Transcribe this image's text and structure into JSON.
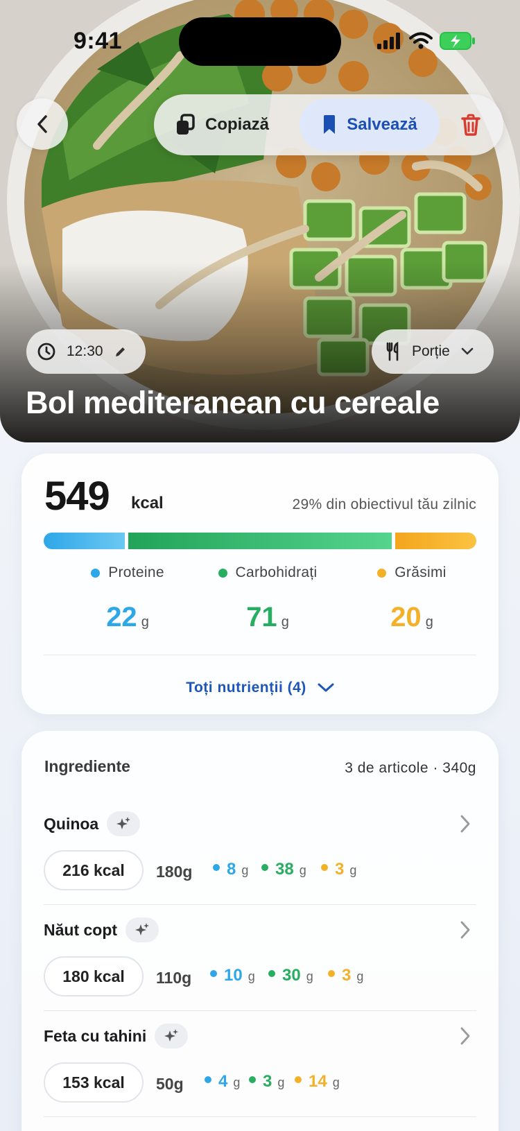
{
  "status_bar": {
    "time": "9:41"
  },
  "header": {
    "copy_label": "Copiază",
    "save_label": "Salvează",
    "time_value": "12:30",
    "portion_label": "Porție",
    "title": "Bol mediteranean cu cereale"
  },
  "nutrition": {
    "kcal": "549",
    "kcal_unit": "kcal",
    "goal_text": "29% din obiectivul tău zilnic",
    "bar_fractions": {
      "protein": 0.19,
      "carbs": 0.62,
      "fat": 0.19
    },
    "macros": [
      {
        "label": "Proteine",
        "value": "22",
        "unit": "g",
        "color": "#2ea7e8"
      },
      {
        "label": "Carbohidrați",
        "value": "71",
        "unit": "g",
        "color": "#27ae60"
      },
      {
        "label": "Grăsimi",
        "value": "20",
        "unit": "g",
        "color": "#f3b12a"
      }
    ],
    "all_nutrients_label": "Toți nutrienții (4)"
  },
  "ingredients": {
    "heading": "Ingrediente",
    "summary": "3 de articole · 340g",
    "items": [
      {
        "name": "Quinoa",
        "kcal": "216 kcal",
        "grams": "180g",
        "protein": "8",
        "carbs": "38",
        "fat": "3",
        "unit": "g"
      },
      {
        "name": "Năut copt",
        "kcal": "180 kcal",
        "grams": "110g",
        "protein": "10",
        "carbs": "30",
        "fat": "3",
        "unit": "g"
      },
      {
        "name": "Feta cu tahini",
        "kcal": "153 kcal",
        "grams": "50g",
        "protein": "4",
        "carbs": "3",
        "fat": "14",
        "unit": "g"
      }
    ]
  },
  "colors": {
    "protein": "#2ea7e8",
    "carbs": "#27ae60",
    "fat": "#f3b12a",
    "accent": "#1c56b8",
    "danger": "#d93a2e"
  }
}
